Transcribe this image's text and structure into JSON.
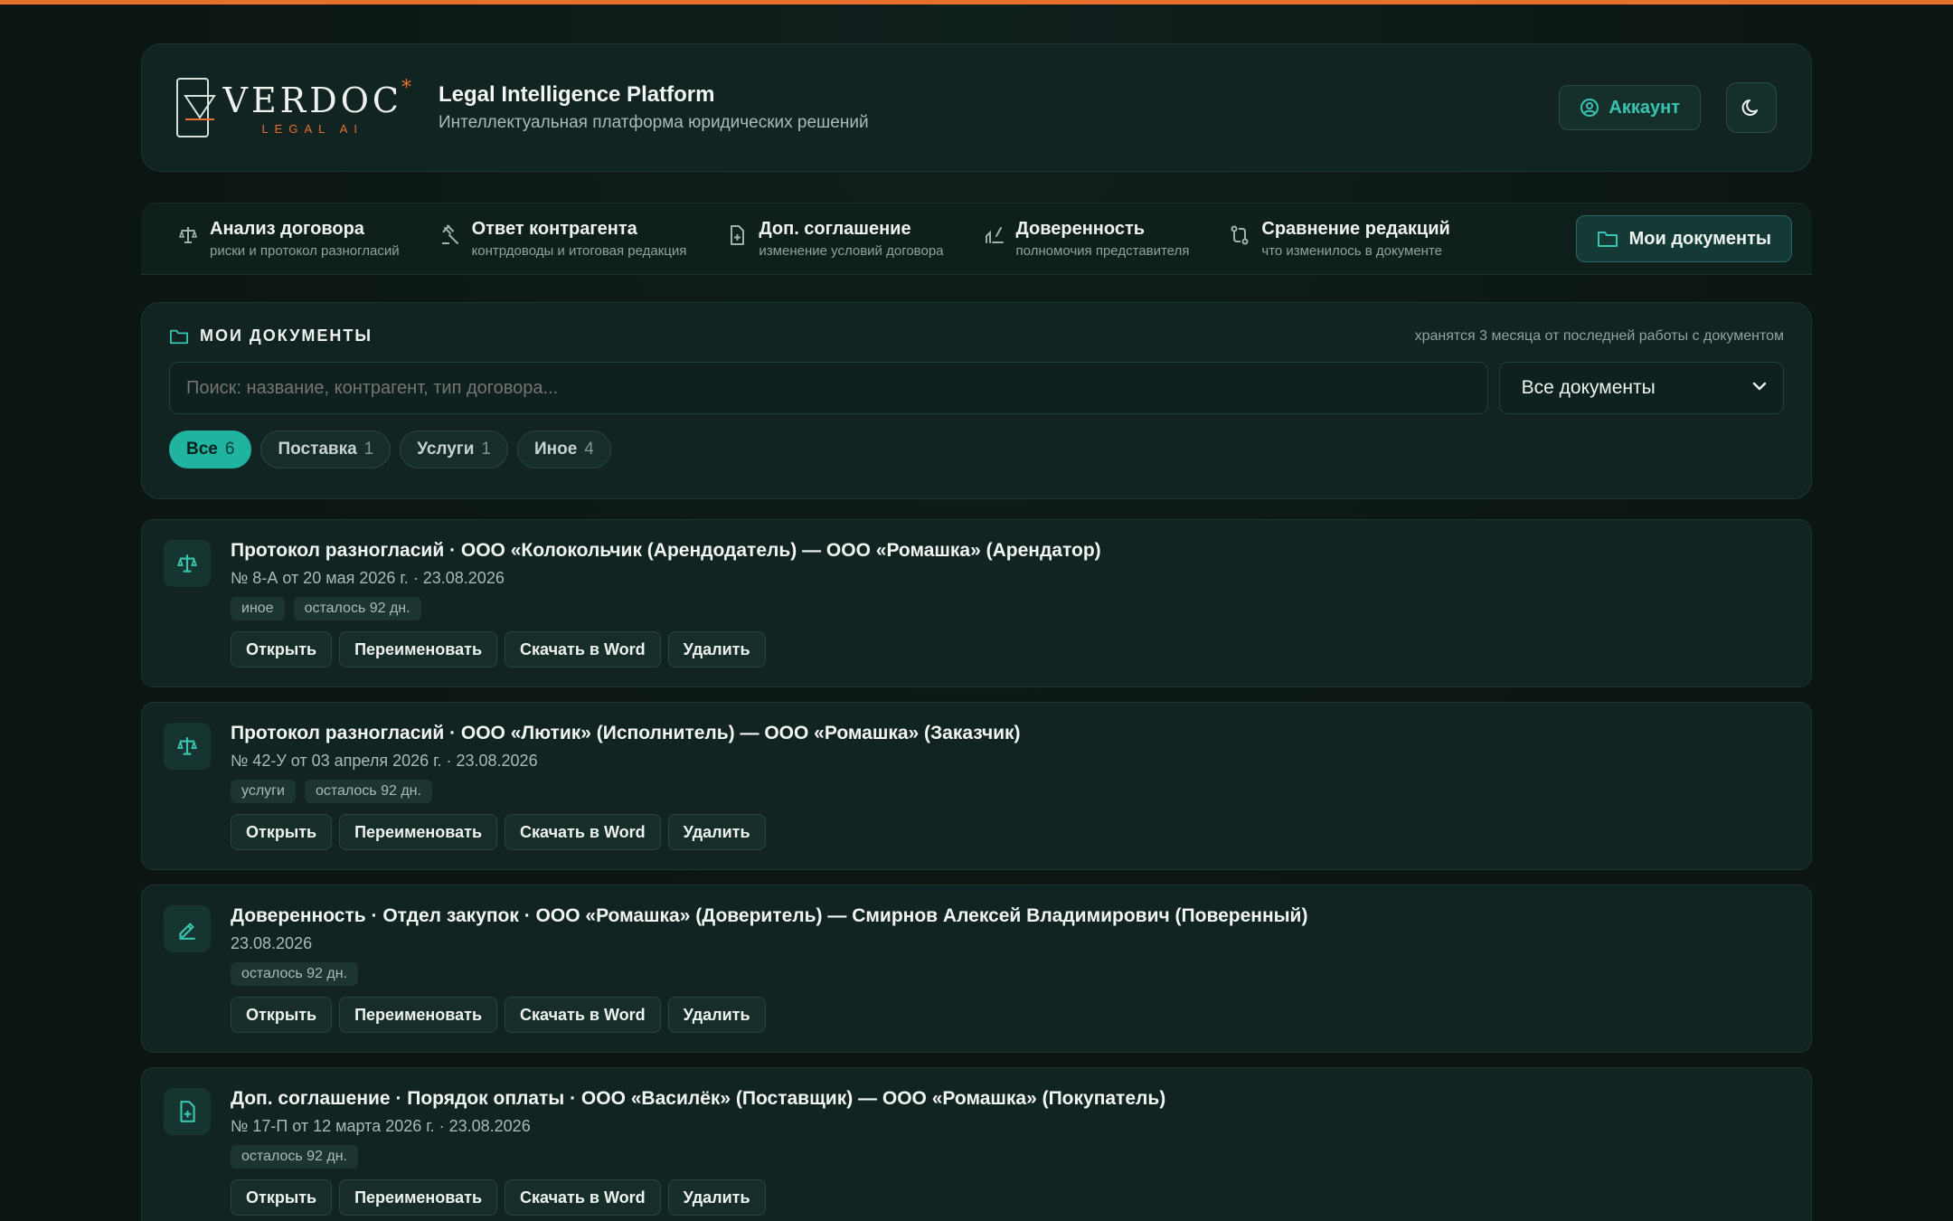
{
  "header": {
    "logo_word": "VERDOC",
    "logo_sub": "LEGAL AI",
    "title": "Legal Intelligence Platform",
    "subtitle": "Интеллектуальная платформа юридических решений",
    "account_label": "Аккаунт"
  },
  "tabs": [
    {
      "label": "Анализ договора",
      "sub": "риски и протокол разногласий",
      "icon": "scales-icon"
    },
    {
      "label": "Ответ контрагента",
      "sub": "контрдоводы и итоговая редакция",
      "icon": "gavel-icon"
    },
    {
      "label": "Доп. соглашение",
      "sub": "изменение условий договора",
      "icon": "file-plus-icon"
    },
    {
      "label": "Доверенность",
      "sub": "полномочия представителя",
      "icon": "signature-icon"
    },
    {
      "label": "Сравнение редакций",
      "sub": "что изменилось в документе",
      "icon": "compare-icon"
    }
  ],
  "active_tab": {
    "label": "Мои документы"
  },
  "docs_panel": {
    "title": "МОИ ДОКУМЕНТЫ",
    "note": "хранятся 3 месяца от последней работы с документом",
    "search_placeholder": "Поиск: название, контрагент, тип договора...",
    "filter_selected": "Все документы",
    "chips": [
      {
        "label": "Все",
        "count": "6",
        "active": true
      },
      {
        "label": "Поставка",
        "count": "1",
        "active": false
      },
      {
        "label": "Услуги",
        "count": "1",
        "active": false
      },
      {
        "label": "Иное",
        "count": "4",
        "active": false
      }
    ]
  },
  "actions": {
    "open": "Открыть",
    "rename": "Переименовать",
    "download": "Скачать в Word",
    "delete": "Удалить"
  },
  "documents": [
    {
      "icon": "scales-icon",
      "title": "Протокол разногласий · ООО «Колокольчик (Арендодатель) — ООО «Ромашка» (Арендатор)",
      "meta": "№ 8-А от 20 мая 2026 г. · 23.08.2026",
      "tags": [
        "иное",
        "осталось 92 дн."
      ]
    },
    {
      "icon": "scales-icon",
      "title": "Протокол разногласий · ООО «Лютик» (Исполнитель) — ООО «Ромашка» (Заказчик)",
      "meta": "№ 42-У от 03 апреля 2026 г. · 23.08.2026",
      "tags": [
        "услуги",
        "осталось 92 дн."
      ]
    },
    {
      "icon": "pen-icon",
      "title": "Доверенность · Отдел закупок · ООО «Ромашка» (Доверитель) — Смирнов Алексей Владимирович (Поверенный)",
      "meta": "23.08.2026",
      "tags": [
        "осталось 92 дн."
      ]
    },
    {
      "icon": "file-plus-icon",
      "title": "Доп. соглашение · Порядок оплаты · ООО «Василёк» (Поставщик) — ООО «Ромашка» (Покупатель)",
      "meta": "№ 17-П от 12 марта 2026 г. · 23.08.2026",
      "tags": [
        "осталось 92 дн."
      ]
    }
  ],
  "colors": {
    "accent": "#1fb3a0",
    "brand_orange": "#e8702e",
    "background": "#0c1715"
  }
}
